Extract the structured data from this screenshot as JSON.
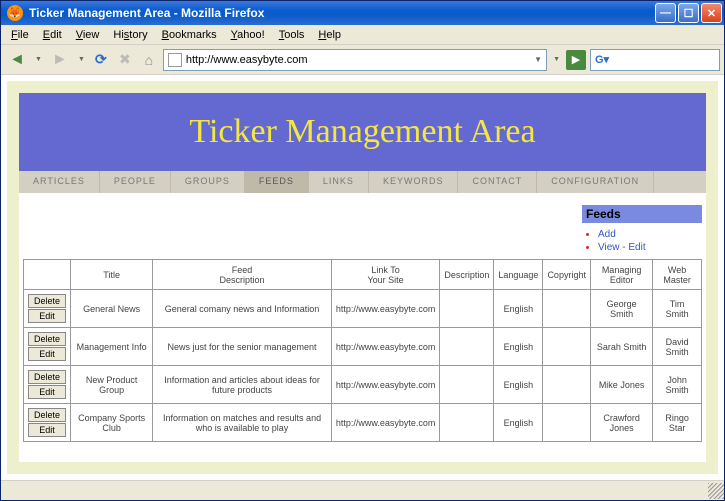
{
  "window": {
    "title": "Ticker Management Area - Mozilla Firefox"
  },
  "menus": {
    "file": "File",
    "edit": "Edit",
    "view": "View",
    "history": "History",
    "bookmarks": "Bookmarks",
    "yahoo": "Yahoo!",
    "tools": "Tools",
    "help": "Help"
  },
  "url": "http://www.easybyte.com",
  "banner": {
    "title": "Ticker Management Area"
  },
  "tabs": {
    "articles": "ARTICLES",
    "people": "PEOPLE",
    "groups": "GROUPS",
    "feeds": "FEEDS",
    "links": "LINKS",
    "keywords": "KEYWORDS",
    "contact": "CONTACT",
    "configuration": "CONFIGURATION"
  },
  "sidebar": {
    "heading": "Feeds",
    "items": [
      "Add",
      "View - Edit"
    ]
  },
  "table": {
    "actions": {
      "delete": "Delete",
      "edit": "Edit"
    },
    "headers": {
      "title": "Title",
      "feed_desc": "Feed\nDescription",
      "link": "Link To\nYour Site",
      "desc": "Description",
      "lang": "Language",
      "copy": "Copyright",
      "editor": "Managing\nEditor",
      "master": "Web\nMaster"
    },
    "rows": [
      {
        "title": "General News",
        "feed": "General comany news and Information",
        "link": "http://www.easybyte.com",
        "desc": "",
        "lang": "English",
        "copy": "",
        "editor": "George Smith",
        "master": "Tim Smith"
      },
      {
        "title": "Management Info",
        "feed": "News just for the senior management",
        "link": "http://www.easybyte.com",
        "desc": "",
        "lang": "English",
        "copy": "",
        "editor": "Sarah Smith",
        "master": "David Smith"
      },
      {
        "title": "New Product Group",
        "feed": "Information and articles about ideas for future products",
        "link": "http://www.easybyte.com",
        "desc": "",
        "lang": "English",
        "copy": "",
        "editor": "Mike Jones",
        "master": "John Smith"
      },
      {
        "title": "Company Sports Club",
        "feed": "Information on matches and results and who is available to play",
        "link": "http://www.easybyte.com",
        "desc": "",
        "lang": "English",
        "copy": "",
        "editor": "Crawford Jones",
        "master": "Ringo Star"
      }
    ]
  }
}
